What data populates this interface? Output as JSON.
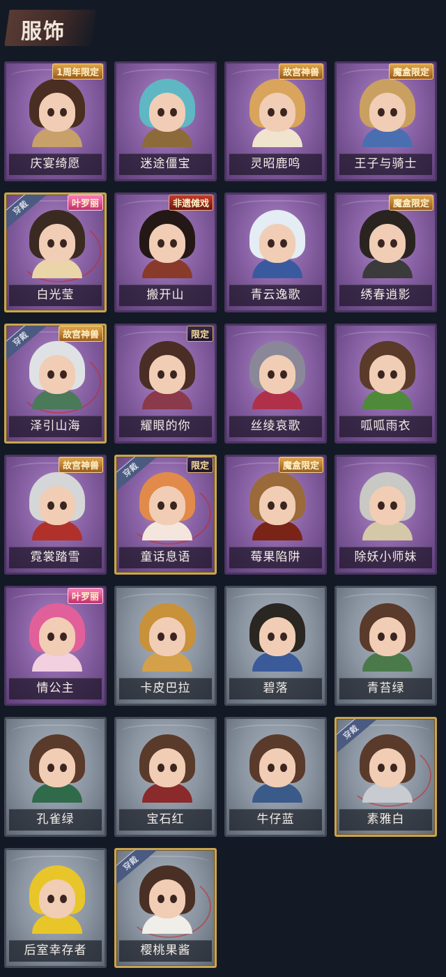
{
  "header": {
    "title": "服饰"
  },
  "colors": {
    "purple_card": "#8a63a6",
    "gray_card": "#8b95a2",
    "gold_border": "#c9a552",
    "background": "#131a26"
  },
  "worn_label": "穿戴",
  "cards": [
    {
      "name": "庆宴绮愿",
      "tier": "purple",
      "tag": "1周年限定",
      "tag_style": "gold",
      "worn": false,
      "hair": "#4a2e22",
      "outfit": "#c7a06a"
    },
    {
      "name": "迷途僵宝",
      "tier": "purple",
      "tag": "",
      "tag_style": "",
      "worn": false,
      "hair": "#5fb7c4",
      "outfit": "#8d6a3a"
    },
    {
      "name": "灵昭鹿鸣",
      "tier": "purple",
      "tag": "故宫神兽",
      "tag_style": "gold",
      "worn": false,
      "hair": "#d9a45c",
      "outfit": "#f0e4cf"
    },
    {
      "name": "王子与骑士",
      "tier": "purple",
      "tag": "魔盒限定",
      "tag_style": "gold",
      "worn": false,
      "hair": "#caa060",
      "outfit": "#4a6fb0"
    },
    {
      "name": "白光莹",
      "tier": "purple",
      "tag": "叶罗丽",
      "tag_style": "pink",
      "worn": true,
      "hair": "#3b2a22",
      "outfit": "#e9d5a8"
    },
    {
      "name": "搬开山",
      "tier": "purple",
      "tag": "非遗傩戏",
      "tag_style": "red",
      "worn": false,
      "hair": "#241816",
      "outfit": "#8a3a2a"
    },
    {
      "name": "青云逸歌",
      "tier": "purple",
      "tag": "",
      "tag_style": "",
      "worn": false,
      "hair": "#e4ecf4",
      "outfit": "#3a5aa0"
    },
    {
      "name": "绣春逍影",
      "tier": "purple",
      "tag": "魔盒限定",
      "tag_style": "gold",
      "worn": false,
      "hair": "#2a2420",
      "outfit": "#3b3b3b"
    },
    {
      "name": "泽引山海",
      "tier": "purple",
      "tag": "故宫神兽",
      "tag_style": "gold",
      "worn": true,
      "hair": "#dfe2e4",
      "outfit": "#4a7a5a"
    },
    {
      "name": "耀眼的你",
      "tier": "purple",
      "tag": "限定",
      "tag_style": "dark",
      "worn": false,
      "hair": "#4a2e25",
      "outfit": "#8a3a4a"
    },
    {
      "name": "丝绫哀歌",
      "tier": "purple",
      "tag": "",
      "tag_style": "",
      "worn": false,
      "hair": "#8a8898",
      "outfit": "#b0304a"
    },
    {
      "name": "呱呱雨衣",
      "tier": "purple",
      "tag": "",
      "tag_style": "",
      "worn": false,
      "hair": "#5a3a28",
      "outfit": "#4f8a3a"
    },
    {
      "name": "霓裳踏雪",
      "tier": "purple",
      "tag": "故宫神兽",
      "tag_style": "gold",
      "worn": false,
      "hair": "#d4d6d8",
      "outfit": "#b0302a"
    },
    {
      "name": "童话息语",
      "tier": "purple",
      "tag": "限定",
      "tag_style": "dark",
      "worn": true,
      "hair": "#e28a4a",
      "outfit": "#f4e6dc"
    },
    {
      "name": "莓果陷阱",
      "tier": "purple",
      "tag": "魔盒限定",
      "tag_style": "gold",
      "worn": false,
      "hair": "#9a6a3a",
      "outfit": "#7a2418"
    },
    {
      "name": "除妖小师妹",
      "tier": "purple",
      "tag": "",
      "tag_style": "",
      "worn": false,
      "hair": "#c8c8c4",
      "outfit": "#d4c8a8"
    },
    {
      "name": "情公主",
      "tier": "purple",
      "tag": "叶罗丽",
      "tag_style": "pink",
      "worn": false,
      "hair": "#e2609a",
      "outfit": "#f2d0e0"
    },
    {
      "name": "卡皮巴拉",
      "tier": "gray",
      "tag": "",
      "tag_style": "",
      "worn": false,
      "hair": "#c8913a",
      "outfit": "#d4a04a"
    },
    {
      "name": "碧落",
      "tier": "gray",
      "tag": "",
      "tag_style": "",
      "worn": false,
      "hair": "#2a2622",
      "outfit": "#3a5a9a"
    },
    {
      "name": "青苔绿",
      "tier": "gray",
      "tag": "",
      "tag_style": "",
      "worn": false,
      "hair": "#5a3a2a",
      "outfit": "#4a7a4a"
    },
    {
      "name": "孔雀绿",
      "tier": "gray",
      "tag": "",
      "tag_style": "",
      "worn": false,
      "hair": "#5a3a2a",
      "outfit": "#2f6a4a"
    },
    {
      "name": "宝石红",
      "tier": "gray",
      "tag": "",
      "tag_style": "",
      "worn": false,
      "hair": "#5a3a2a",
      "outfit": "#8a2a2a"
    },
    {
      "name": "牛仔蓝",
      "tier": "gray",
      "tag": "",
      "tag_style": "",
      "worn": false,
      "hair": "#5a3a2a",
      "outfit": "#3a5a8a"
    },
    {
      "name": "素雅白",
      "tier": "gray",
      "tag": "",
      "tag_style": "",
      "worn": true,
      "hair": "#5a3a2a",
      "outfit": "#c8ccd0"
    },
    {
      "name": "后室幸存者",
      "tier": "gray",
      "tag": "",
      "tag_style": "",
      "worn": false,
      "hair": "#e8c62a",
      "outfit": "#e8c62a"
    },
    {
      "name": "樱桃果酱",
      "tier": "gray",
      "tag": "",
      "tag_style": "",
      "worn": true,
      "hair": "#4a3024",
      "outfit": "#f0eee8"
    }
  ]
}
